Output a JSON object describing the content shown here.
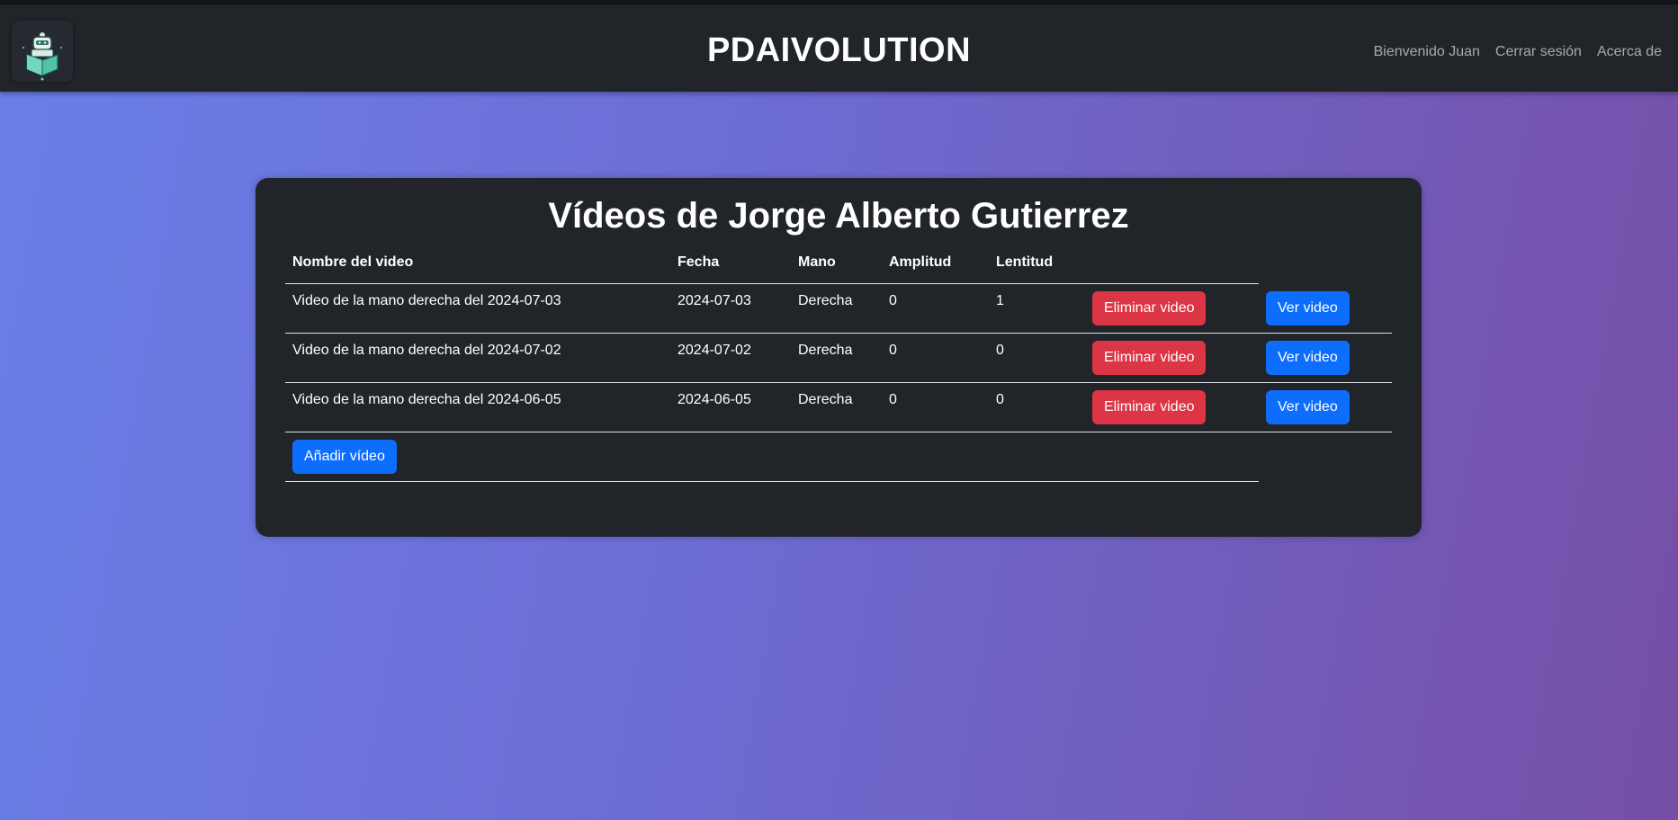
{
  "navbar": {
    "brand": "PDAIVOLUTION",
    "links": [
      "Bienvenido Juan",
      "Cerrar sesión",
      "Acerca de"
    ]
  },
  "card": {
    "title": "Vídeos de Jorge Alberto Gutierrez"
  },
  "table": {
    "headers": [
      "Nombre del video",
      "Fecha",
      "Mano",
      "Amplitud",
      "Lentitud"
    ],
    "rows": [
      {
        "name": "Video de la mano derecha del 2024-07-03",
        "date": "2024-07-03",
        "hand": "Derecha",
        "amplitude": "0",
        "slowness": "1",
        "delete_label": "Eliminar video",
        "view_label": "Ver video"
      },
      {
        "name": "Video de la mano derecha del 2024-07-02",
        "date": "2024-07-02",
        "hand": "Derecha",
        "amplitude": "0",
        "slowness": "0",
        "delete_label": "Eliminar video",
        "view_label": "Ver video"
      },
      {
        "name": "Video de la mano derecha del 2024-06-05",
        "date": "2024-06-05",
        "hand": "Derecha",
        "amplitude": "0",
        "slowness": "0",
        "delete_label": "Eliminar video",
        "view_label": "Ver video"
      }
    ],
    "add_label": "Añadir vídeo"
  },
  "colors": {
    "navbar_bg": "#212529",
    "card_bg": "#212529",
    "danger": "#dc3545",
    "primary": "#0d6efd",
    "gradient_start": "#6a7fe9",
    "gradient_end": "#764fa6"
  },
  "icons": {
    "logo": "robot-logo-icon"
  }
}
